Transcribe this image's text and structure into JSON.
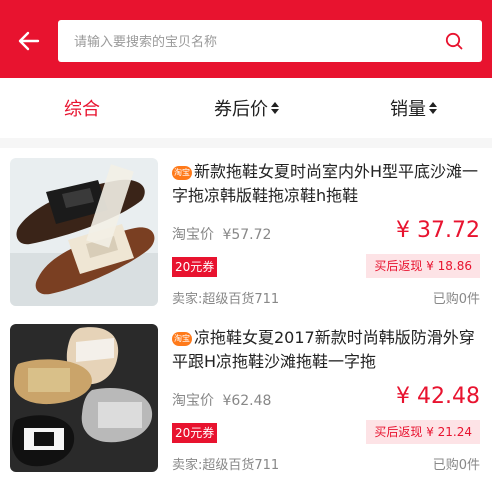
{
  "search": {
    "placeholder": "请输入要搜索的宝贝名称",
    "value": ""
  },
  "sort": {
    "tabs": [
      {
        "label": "综合",
        "active": true
      },
      {
        "label": "券后价",
        "active": false
      },
      {
        "label": "销量",
        "active": false
      }
    ]
  },
  "products": [
    {
      "badge": "淘宝",
      "title": "新款拖鞋女夏时尚室内外H型平底沙滩一字拖凉韩版鞋拖凉鞋h拖鞋",
      "taobao_price_label": "淘宝价",
      "taobao_price": "¥57.72",
      "price": "¥ 37.72",
      "coupon": "20元券",
      "cashback": "买后返现 ¥ 18.86",
      "seller": "卖家:超级百货711",
      "sold": "已购0件"
    },
    {
      "badge": "淘宝",
      "title": "凉拖鞋女夏2017新款时尚韩版防滑外穿平跟H凉拖鞋沙滩拖鞋一字拖",
      "taobao_price_label": "淘宝价",
      "taobao_price": "¥62.48",
      "price": "¥ 42.48",
      "coupon": "20元券",
      "cashback": "买后返现 ¥ 21.24",
      "seller": "卖家:超级百货711",
      "sold": "已购0件"
    }
  ],
  "colors": {
    "accent": "#e8132f",
    "badge": "#ff7a1a",
    "cashback_bg": "#fde3e6"
  }
}
